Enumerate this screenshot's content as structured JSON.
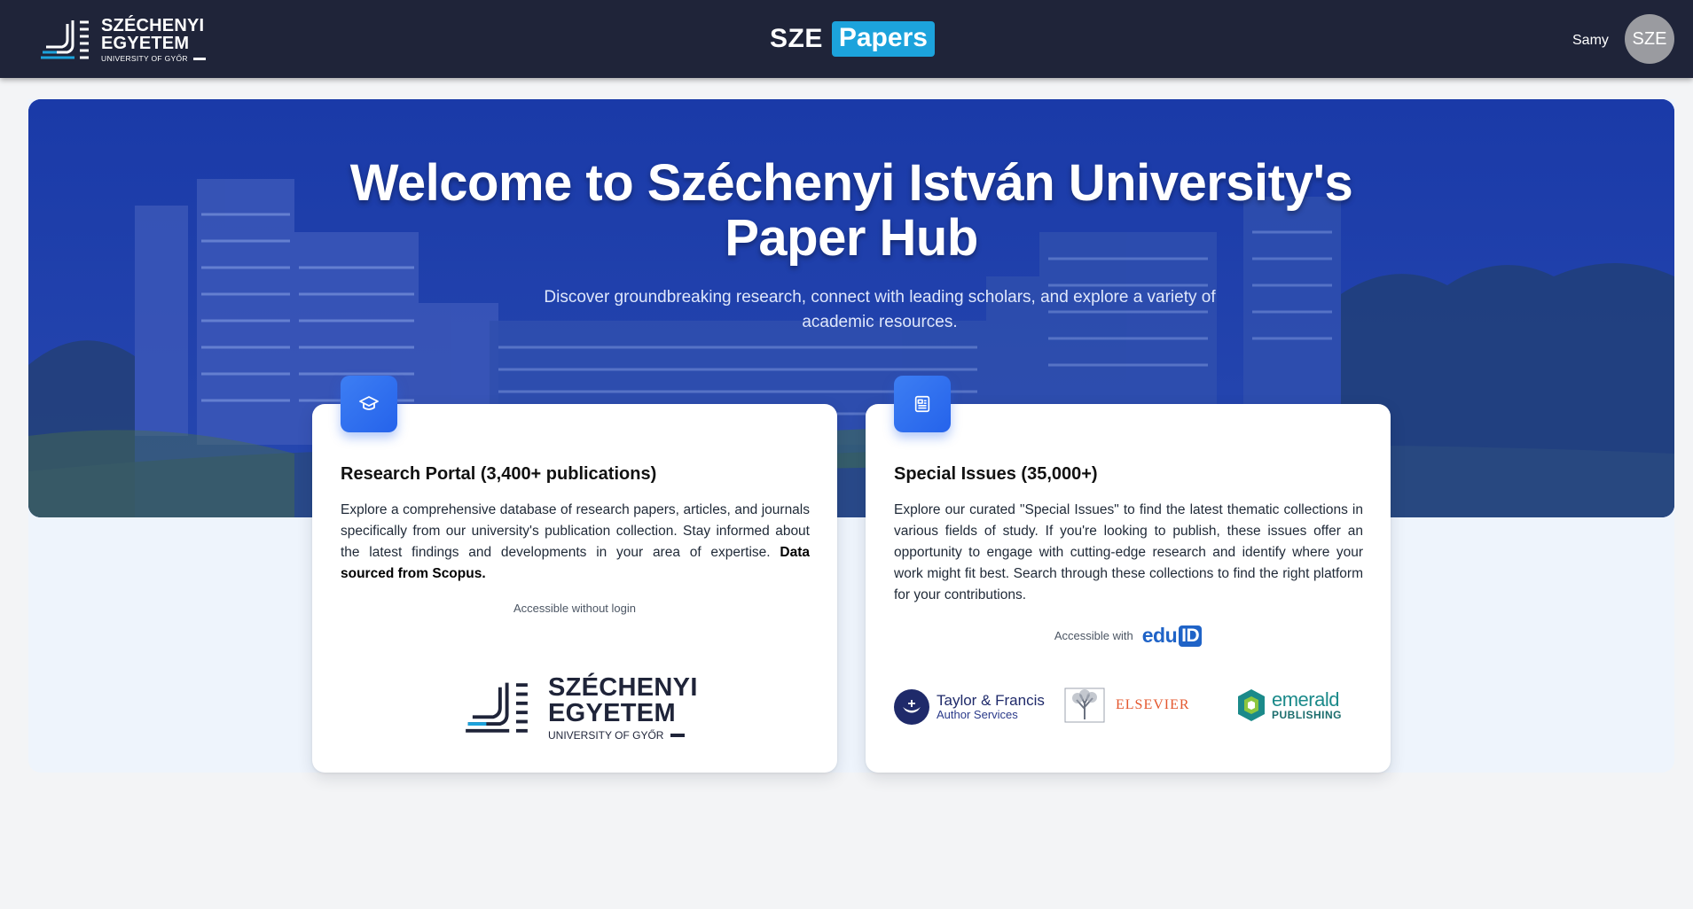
{
  "header": {
    "logo": {
      "line1": "SZÉCHENYI",
      "line2": "EGYETEM",
      "line3": "UNIVERSITY OF GYŐR"
    },
    "brand": {
      "prefix": "SZE",
      "highlight": "Papers"
    },
    "user": {
      "name": "Samy",
      "avatar_initials": "SZE"
    }
  },
  "hero": {
    "title_line1": "Welcome to Széchenyi István University's",
    "title_line2": "Paper Hub",
    "subtitle": "Discover groundbreaking research, connect with leading scholars, and explore a variety of academic resources."
  },
  "cards": [
    {
      "icon": "graduation-cap-icon",
      "title": "Research Portal (3,400+ publications)",
      "body": "Explore a comprehensive database of research papers, articles, and journals specifically from our university's publication collection. Stay informed about the latest findings and developments in your area of expertise.",
      "body_bold": "Data sourced from Scopus.",
      "access": "Accessible without login",
      "logo": {
        "line1": "SZÉCHENYI",
        "line2": "EGYETEM",
        "line3": "UNIVERSITY OF GYŐR"
      }
    },
    {
      "icon": "newspaper-icon",
      "title": "Special Issues (35,000+)",
      "body": "Explore our curated \"Special Issues\" to find the latest thematic collections in various fields of study. If you're looking to publish, these issues offer an opportunity to engage with cutting-edge research and identify where your work might fit best. Search through these collections to find the right platform for your contributions.",
      "access": "Accessible with",
      "access_logo": {
        "prefix": "edu",
        "suffix": "ID"
      },
      "publishers": [
        {
          "name": "Taylor & Francis",
          "sub": "Author Services"
        },
        {
          "name": "ELSEVIER"
        },
        {
          "name": "emerald",
          "sub": "PUBLISHING"
        }
      ]
    }
  ],
  "colors": {
    "header_bg": "#1f2439",
    "brand_highlight": "#1ca3dc",
    "hero_overlay": "#1f40aa",
    "accent": "#2563eb",
    "page_bg": "#f3f4f6",
    "band_bg": "#eef4fc"
  }
}
